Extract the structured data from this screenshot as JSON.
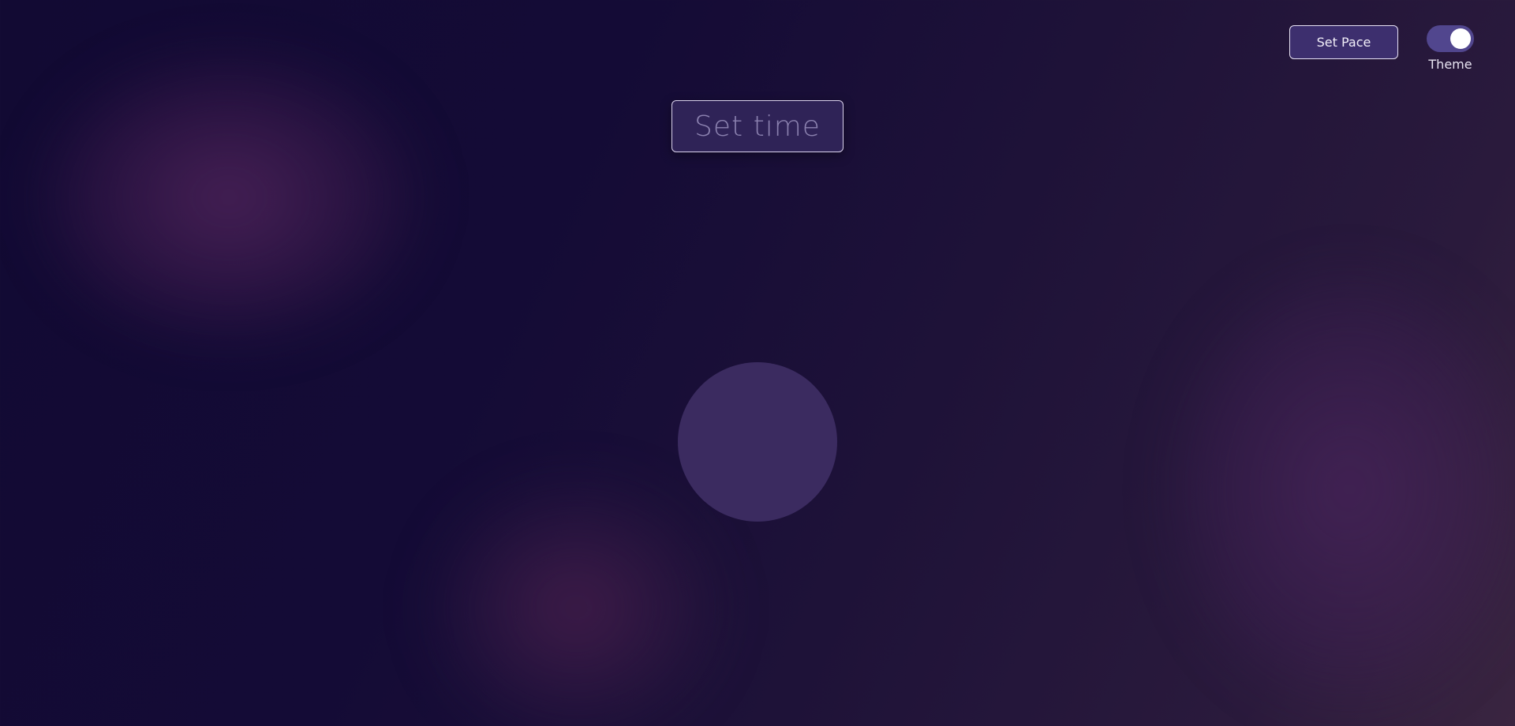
{
  "header": {
    "pace_button_label": "Set Pace",
    "theme_label": "Theme",
    "theme_toggle_on": true
  },
  "timer": {
    "placeholder": "Set time"
  },
  "colors": {
    "background": "#140b36",
    "accent": "#3d2f6e",
    "circle": "#3b2b60",
    "toggle_track": "#51468e"
  }
}
